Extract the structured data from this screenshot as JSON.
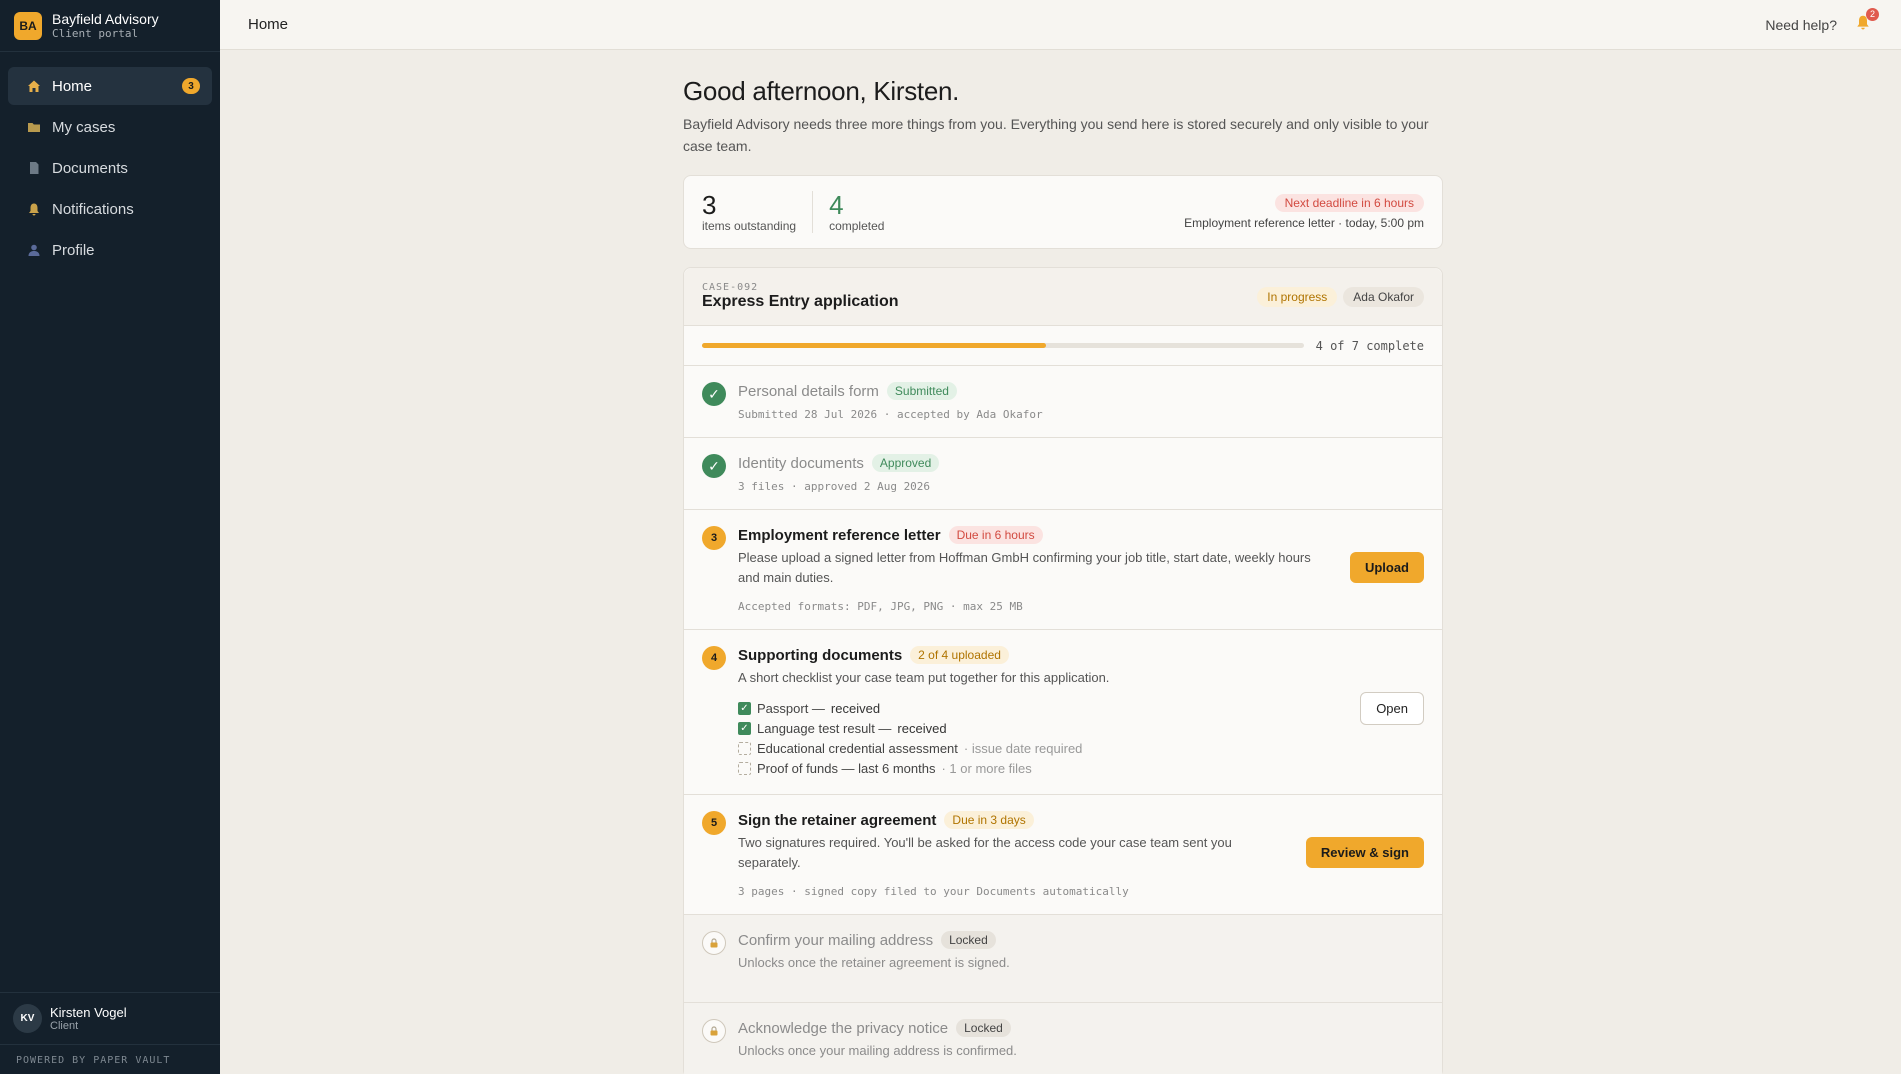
{
  "brand": {
    "initials": "BA",
    "name": "Bayfield Advisory",
    "subtitle": "Client portal"
  },
  "nav": [
    {
      "label": "Home",
      "icon": "home-icon",
      "badge": "3",
      "active": true
    },
    {
      "label": "My cases",
      "icon": "folder-icon"
    },
    {
      "label": "Documents",
      "icon": "document-icon"
    },
    {
      "label": "Notifications",
      "icon": "bell-icon"
    },
    {
      "label": "Profile",
      "icon": "person-icon"
    }
  ],
  "user": {
    "initials": "KV",
    "name": "Kirsten Vogel",
    "role": "Client"
  },
  "powered_by": "POWERED BY PAPER VAULT",
  "topbar": {
    "title": "Home",
    "help": "Need help?",
    "notification_count": "2"
  },
  "greeting": "Good afternoon, Kirsten.",
  "intro": "Bayfield Advisory needs three more things from you. Everything you send here is stored securely and only visible to your case team.",
  "summary": {
    "outstanding_count": "3",
    "outstanding_label": "items outstanding",
    "completed_count": "4",
    "completed_label": "completed",
    "deadline_badge": "Next deadline in 6 hours",
    "deadline_text": "Employment reference letter · today, 5:00 pm"
  },
  "case": {
    "id": "CASE-092",
    "title": "Express Entry application",
    "status": "In progress",
    "owner": "Ada Okafor",
    "progress_fraction": 0.571,
    "progress_label": "4 of 7 complete",
    "tasks": [
      {
        "title": "Personal details form",
        "pill": "Submitted",
        "meta": "Submitted 28 Jul 2026 · accepted by Ada Okafor"
      },
      {
        "title": "Identity documents",
        "pill": "Approved",
        "meta": "3 files · approved 2 Aug 2026"
      },
      {
        "number": "3",
        "title": "Employment reference letter",
        "pill": "Due in 6 hours",
        "desc": "Please upload a signed letter from Hoffman GmbH confirming your job title, start date, weekly hours and main duties.",
        "meta": "Accepted formats: PDF, JPG, PNG · max 25 MB",
        "button": "Upload"
      },
      {
        "number": "4",
        "title": "Supporting documents",
        "pill": "2 of 4 uploaded",
        "desc": "A short checklist your case team put together for this application.",
        "button": "Open",
        "checklist": [
          {
            "label": "Passport —",
            "status": "received"
          },
          {
            "label": "Language test result —",
            "status": "received"
          },
          {
            "label": "Educational credential assessment",
            "note": "· issue date required"
          },
          {
            "label": "Proof of funds — last 6 months",
            "note": "· 1 or more files"
          }
        ]
      },
      {
        "number": "5",
        "title": "Sign the retainer agreement",
        "pill": "Due in 3 days",
        "desc": "Two signatures required. You'll be asked for the access code your case team sent you separately.",
        "meta": "3 pages · signed copy filed to your Documents automatically",
        "button": "Review & sign"
      },
      {
        "title": "Confirm your mailing address",
        "pill": "Locked",
        "desc": "Unlocks once the retainer agreement is signed."
      },
      {
        "title": "Acknowledge the privacy notice",
        "pill": "Locked",
        "desc": "Unlocks once your mailing address is confirmed."
      }
    ]
  }
}
